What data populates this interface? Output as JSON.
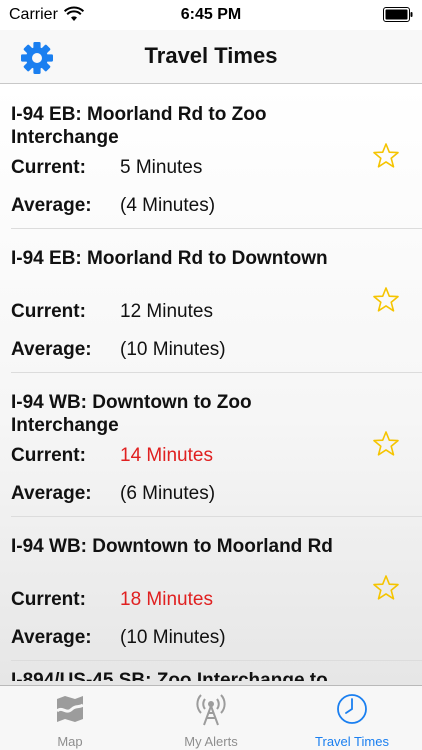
{
  "status_bar": {
    "carrier": "Carrier",
    "time": "6:45 PM"
  },
  "nav": {
    "title": "Travel Times",
    "settings_icon": "gear-icon"
  },
  "colors": {
    "accent": "#1a7ff0",
    "alert": "#e02020",
    "star": "#f5c400"
  },
  "routes": [
    {
      "title": "I-94 EB: Moorland Rd to Zoo Interchange",
      "current_label": "Current:",
      "current": "5 Minutes",
      "current_alert": false,
      "average_label": "Average:",
      "average": "(4 Minutes)"
    },
    {
      "title": "I-94 EB: Moorland Rd to Downtown",
      "current_label": "Current:",
      "current": "12 Minutes",
      "current_alert": false,
      "average_label": "Average:",
      "average": "(10 Minutes)"
    },
    {
      "title": "I-94 WB: Downtown to Zoo Interchange",
      "current_label": "Current:",
      "current": "14 Minutes",
      "current_alert": true,
      "average_label": "Average:",
      "average": "(6 Minutes)"
    },
    {
      "title": "I-94 WB: Downtown to Moorland Rd",
      "current_label": "Current:",
      "current": "18 Minutes",
      "current_alert": true,
      "average_label": "Average:",
      "average": "(10 Minutes)"
    }
  ],
  "partial_route": {
    "title": "I-894/US-45 SB: Zoo Interchange to"
  },
  "tabs": [
    {
      "label": "Map",
      "icon": "map-icon",
      "active": false
    },
    {
      "label": "My Alerts",
      "icon": "alert-tower-icon",
      "active": false
    },
    {
      "label": "Travel Times",
      "icon": "clock-icon",
      "active": true
    }
  ]
}
